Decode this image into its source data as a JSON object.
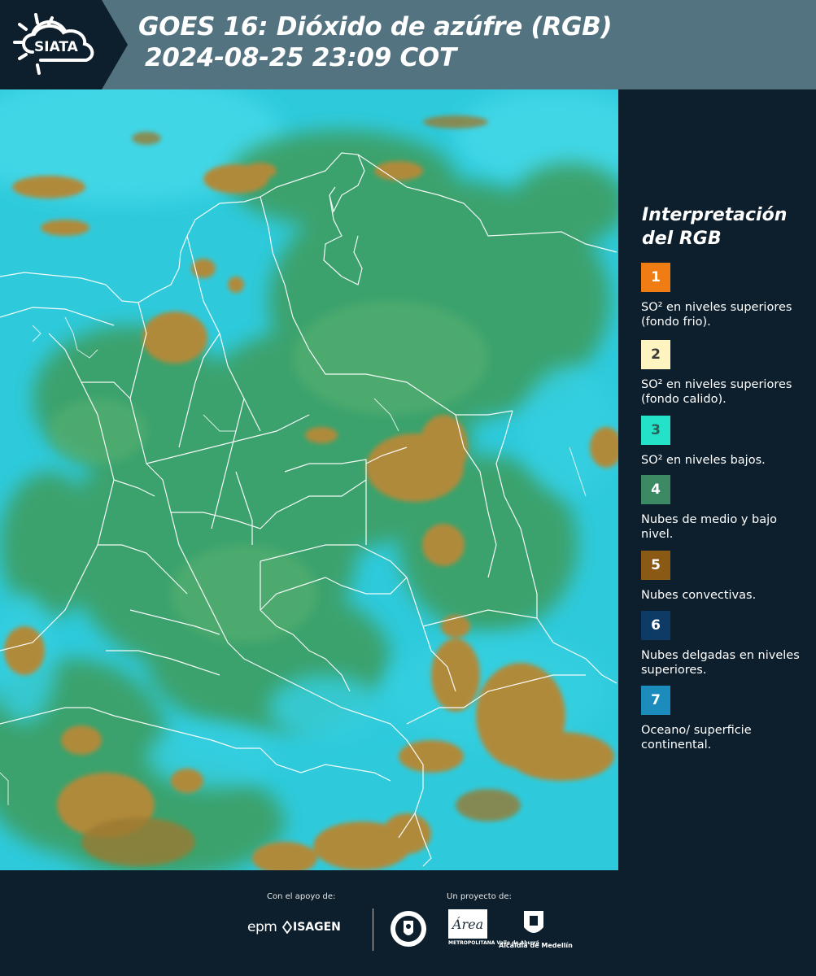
{
  "header": {
    "logo_text": "SIATA",
    "title_line1": "GOES 16: Dióxido de azúfre (RGB)",
    "title_line2": "2024-08-25 23:09 COT"
  },
  "map": {
    "image_description_icon": "satellite-rgb-map",
    "colors": {
      "background": "#2ecadc",
      "cloud_low": "#3a9a5a",
      "convective": "#b08a3a",
      "borders": "#ffffff"
    }
  },
  "legend": {
    "title": "Interpretación del RGB",
    "items": [
      {
        "number": "1",
        "label": "SO² en niveles superiores (fondo frio).",
        "color": "#f07c14",
        "text_color": "#ffffff"
      },
      {
        "number": "2",
        "label": "SO² en niveles superiores (fondo calido).",
        "color": "#fdf4c0",
        "text_color": "#3a3a3a"
      },
      {
        "number": "3",
        "label": "SO² en niveles bajos.",
        "color": "#24e2c8",
        "text_color": "#2e5e5a"
      },
      {
        "number": "4",
        "label": "Nubes de medio y bajo nivel.",
        "color": "#3c8a64",
        "text_color": "#ffffff"
      },
      {
        "number": "5",
        "label": "Nubes convectivas.",
        "color": "#8a5a14",
        "text_color": "#ffffff"
      },
      {
        "number": "6",
        "label": "Nubes delgadas en niveles superiores.",
        "color": "#0e3a66",
        "text_color": "#ffffff"
      },
      {
        "number": "7",
        "label": "Oceano/ superficie continental.",
        "color": "#1c8cbc",
        "text_color": "#ffffff"
      }
    ]
  },
  "footer": {
    "support_label": "Con el apoyo de:",
    "project_label": "Un proyecto de:",
    "sponsor1": "epm",
    "sponsor2": "ISAGEN",
    "partner1": "METROPOLITANA Valle de Aburrá",
    "partner1_logo": "Área",
    "partner2": "Alcaldía de Medellín"
  }
}
